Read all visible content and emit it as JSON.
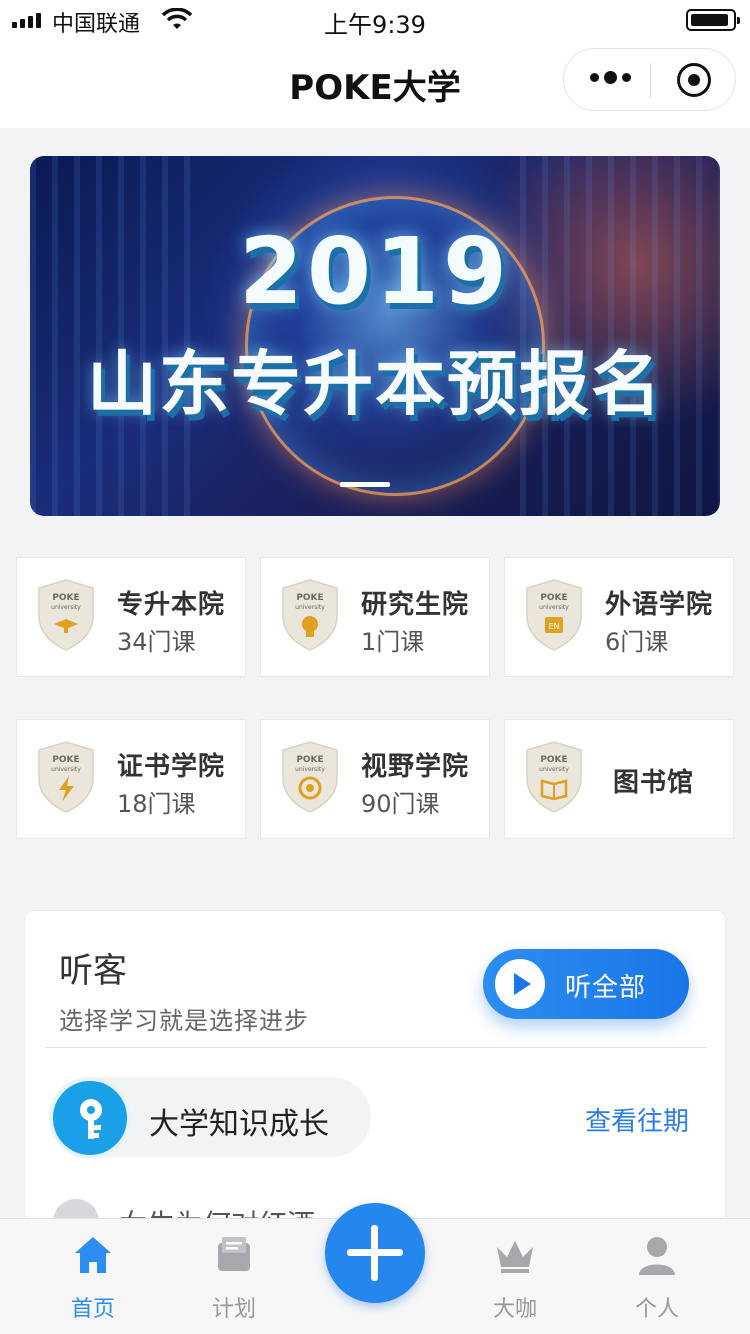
{
  "status_bar": {
    "carrier": "中国联通",
    "time": "上午9:39"
  },
  "nav": {
    "title": "POKE大学"
  },
  "banner": {
    "year": "2019",
    "headline": "山东专升本预报名"
  },
  "categories": [
    {
      "name": "专升本院",
      "count": "34门课",
      "icon": "graduation-cap-icon"
    },
    {
      "name": "研究生院",
      "count": "1门课",
      "icon": "head-icon"
    },
    {
      "name": "外语学院",
      "count": "6门课",
      "icon": "en-book-icon"
    },
    {
      "name": "证书学院",
      "count": "18门课",
      "icon": "lightning-icon"
    },
    {
      "name": "视野学院",
      "count": "90门课",
      "icon": "globe-icon"
    },
    {
      "name": "图书馆",
      "count": "",
      "icon": "open-book-icon"
    }
  ],
  "badge_text": "POKE",
  "badge_subtext": "university",
  "listen": {
    "title": "听客",
    "subtitle": "选择学习就是选择进步",
    "play_all_label": "听全部",
    "topic_label": "大学知识成长",
    "history_link": "查看往期",
    "peek_text": "女生为何对红酒... 钟?"
  },
  "tabbar": {
    "items": [
      {
        "label": "首页",
        "icon": "home-icon",
        "active": true
      },
      {
        "label": "计划",
        "icon": "plan-icon",
        "active": false
      },
      {
        "label": "大咖",
        "icon": "crown-icon",
        "active": false
      },
      {
        "label": "个人",
        "icon": "person-icon",
        "active": false
      }
    ]
  },
  "colors": {
    "accent": "#2586ee",
    "link": "#2b7ee6",
    "tab_active": "#2b8ef0"
  }
}
